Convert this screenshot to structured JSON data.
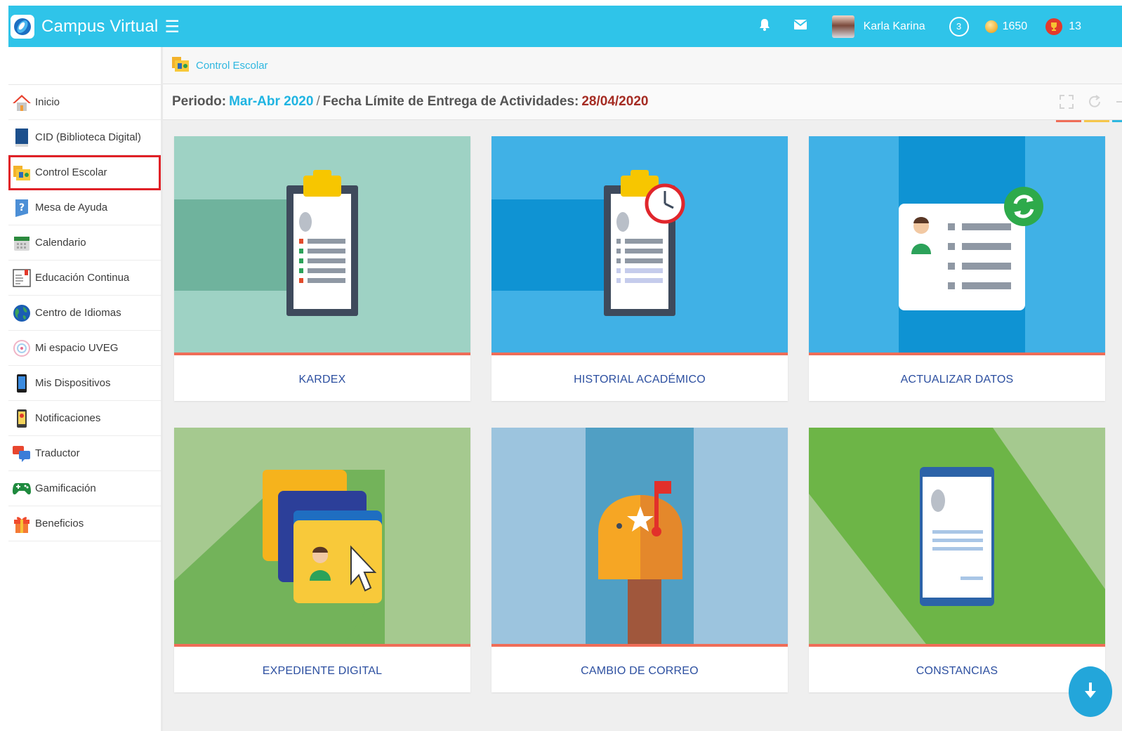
{
  "header": {
    "brand_title": "Campus Virtual",
    "user_name": "Karla Karina",
    "level": "3",
    "coins": "1650",
    "trophies": "13"
  },
  "sidebar": {
    "items": [
      {
        "label": "Inicio",
        "icon": "home-icon"
      },
      {
        "label": "CID (Biblioteca Digital)",
        "icon": "book-icon"
      },
      {
        "label": "Control Escolar",
        "icon": "school-folder-icon"
      },
      {
        "label": "Mesa de Ayuda",
        "icon": "help-icon"
      },
      {
        "label": "Calendario",
        "icon": "calendar-icon"
      },
      {
        "label": "Educación Continua",
        "icon": "document-icon"
      },
      {
        "label": "Centro de Idiomas",
        "icon": "globe-icon"
      },
      {
        "label": "Mi espacio UVEG",
        "icon": "space-icon"
      },
      {
        "label": "Mis Dispositivos",
        "icon": "phone-icon"
      },
      {
        "label": "Notificaciones",
        "icon": "notification-phone-icon"
      },
      {
        "label": "Traductor",
        "icon": "chat-icon"
      },
      {
        "label": "Gamificación",
        "icon": "gamepad-icon"
      },
      {
        "label": "Beneficios",
        "icon": "gift-icon"
      }
    ],
    "active_index": 2
  },
  "breadcrumb": {
    "label": "Control Escolar"
  },
  "period": {
    "label": "Periodo:",
    "value": "Mar-Abr 2020",
    "separator": "/",
    "deadline_label": "Fecha Límite de Entrega de Actividades:",
    "deadline_value": "28/04/2020"
  },
  "cards": [
    {
      "label": "KARDEX"
    },
    {
      "label": "HISTORIAL ACADÉMICO"
    },
    {
      "label": "ACTUALIZAR DATOS"
    },
    {
      "label": "EXPEDIENTE DIGITAL"
    },
    {
      "label": "CAMBIO DE CORREO"
    },
    {
      "label": "CONSTANCIAS"
    }
  ],
  "colors": {
    "topbar": "#2fc4e9",
    "accent_blue": "#1fb4e2",
    "deadline_red": "#a52c23",
    "card_label": "#2c4fa0",
    "card_underline": "#ef6d58",
    "active_outline": "#e02127"
  }
}
